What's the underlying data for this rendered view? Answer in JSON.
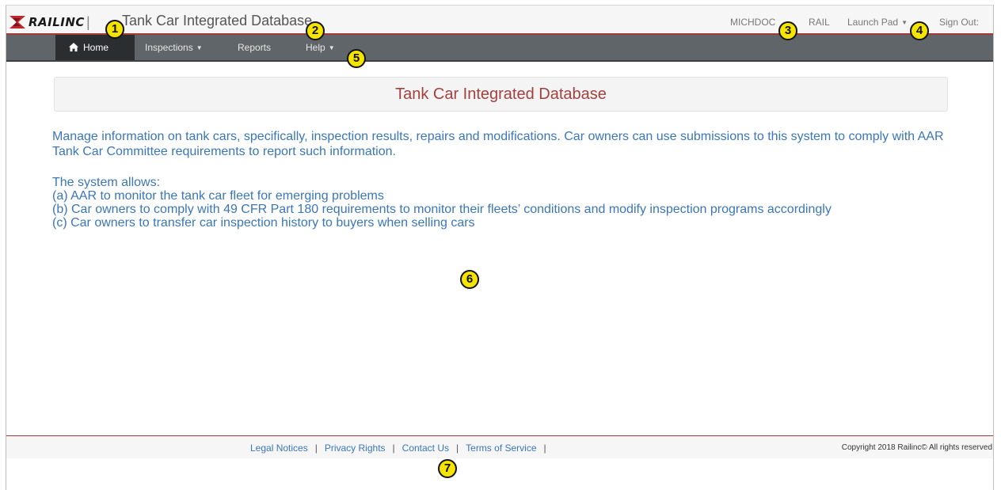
{
  "header": {
    "logo_text": "RAILINC",
    "app_title": "Tank Car Integrated Database",
    "user": "MICHDOC",
    "company": "RAIL",
    "launch_pad": "Launch Pad",
    "sign_out": "Sign Out:"
  },
  "navbar": {
    "home": "Home",
    "inspections": "Inspections",
    "reports": "Reports",
    "help": "Help"
  },
  "main": {
    "banner_title": "Tank Car Integrated Database",
    "description": "Manage information on tank cars, specifically, inspection results, repairs and modifications. Car owners can use submissions to this system to comply with AAR Tank Car Committee requirements to report such information.",
    "allows_heading": "The system allows:",
    "allows_items": [
      "(a) AAR to monitor the tank car fleet for emerging problems",
      "(b) Car owners to comply with 49 CFR Part 180 requirements to monitor their fleets’ conditions and modify inspection programs accordingly",
      "(c) Car owners to transfer car inspection history to buyers when selling cars"
    ]
  },
  "footer": {
    "links": [
      "Legal Notices",
      "Privacy Rights",
      "Contact Us",
      "Terms of Service"
    ],
    "copyright": "Copyright 2018 Railinc© All rights reserved"
  },
  "callouts": [
    "1",
    "2",
    "3",
    "4",
    "5",
    "6",
    "7"
  ],
  "colors": {
    "brand_red": "#a33a38",
    "nav_bg": "#5f6569",
    "nav_active": "#2b2e31",
    "text_blue": "#3a76b8",
    "callout_yellow": "#f5e400"
  },
  "icons": {
    "home": "home-icon",
    "dropdown": "caret-down-icon",
    "logo": "railinc-logo-mark"
  }
}
